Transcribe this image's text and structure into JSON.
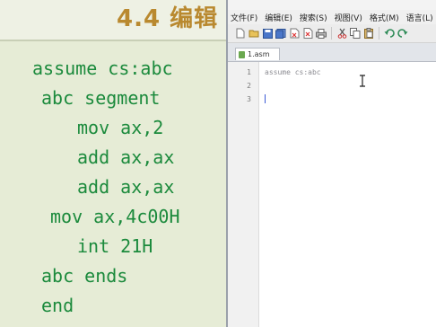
{
  "slide": {
    "title": "4.4 编辑",
    "code_lines": [
      "assume cs:abc",
      "abc segment",
      "mov ax,2",
      "add ax,ax",
      "add ax,ax",
      "mov ax,4c00H",
      "int 21H",
      "abc ends",
      "end"
    ]
  },
  "editor": {
    "menu": [
      "文件(F)",
      "编辑(E)",
      "搜索(S)",
      "视图(V)",
      "格式(M)",
      "语言(L)"
    ],
    "tab_label": "1.asm",
    "line_numbers": [
      "1",
      "2",
      "3"
    ],
    "lines": [
      "assume cs:abc",
      "",
      ""
    ]
  },
  "colors": {
    "code_text": "#1b8a3c",
    "title_text": "#b9892f",
    "editor_text": "#8e8e94",
    "caret": "#3b5bd6"
  },
  "icons": [
    "new-file-icon",
    "open-file-icon",
    "save-icon",
    "save-all-icon",
    "close-icon",
    "close-all-icon",
    "print-icon",
    "cut-icon",
    "copy-icon",
    "paste-icon",
    "undo-icon",
    "redo-icon"
  ]
}
